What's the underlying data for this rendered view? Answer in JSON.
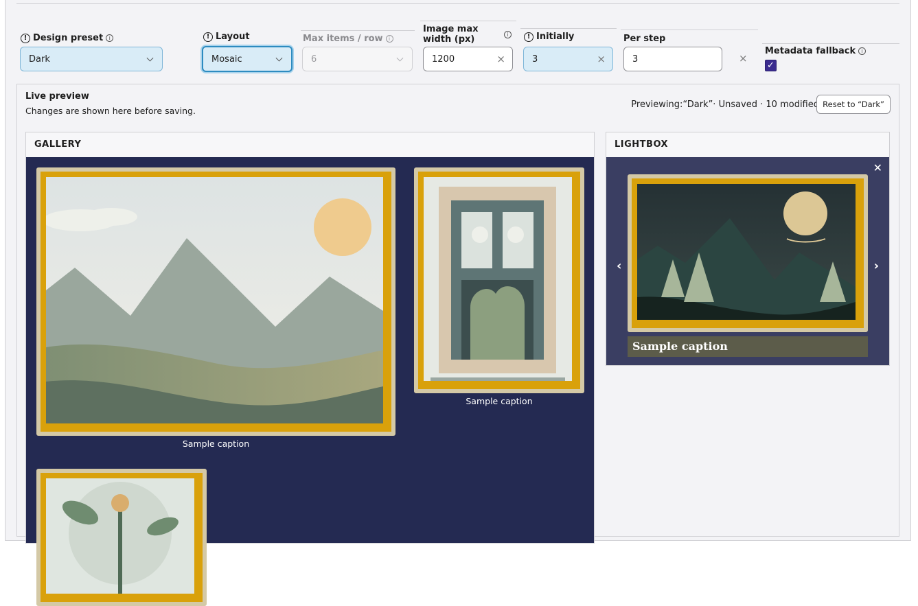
{
  "fields": {
    "design_preset": {
      "label": "Design preset",
      "value": "Dark"
    },
    "layout": {
      "label": "Layout",
      "value": "Mosaic"
    },
    "max_items": {
      "label": "Max items / row",
      "value": "6"
    },
    "image_max_width": {
      "label_line1": "Image max",
      "label_line2": "width (px)",
      "value": "1200"
    },
    "initially": {
      "label": "Initially",
      "value": "3"
    },
    "per_step": {
      "label": "Per step",
      "value": "3"
    },
    "metadata_fallback": {
      "label": "Metadata fallback",
      "checked": true
    }
  },
  "preview": {
    "title": "Live preview",
    "subtitle": "Changes are shown here before saving.",
    "status": "Previewing:“Dark”· Unsaved · 10 modified",
    "reset_label": "Reset to “Dark”"
  },
  "gallery": {
    "heading": "GALLERY",
    "captions": [
      "Sample caption",
      "Sample caption"
    ]
  },
  "lightbox": {
    "heading": "LIGHTBOX",
    "caption": "Sample caption"
  },
  "colors": {
    "gallery_bg": "#242a52",
    "lightbox_bg": "#3a3e62",
    "frame_gold": "#d9a10b",
    "checkbox": "#3b2c8f"
  },
  "icons": {
    "warning": "!",
    "info": "i",
    "clear": "×",
    "close": "✕",
    "prev": "‹",
    "next": "›",
    "check": "✓"
  }
}
